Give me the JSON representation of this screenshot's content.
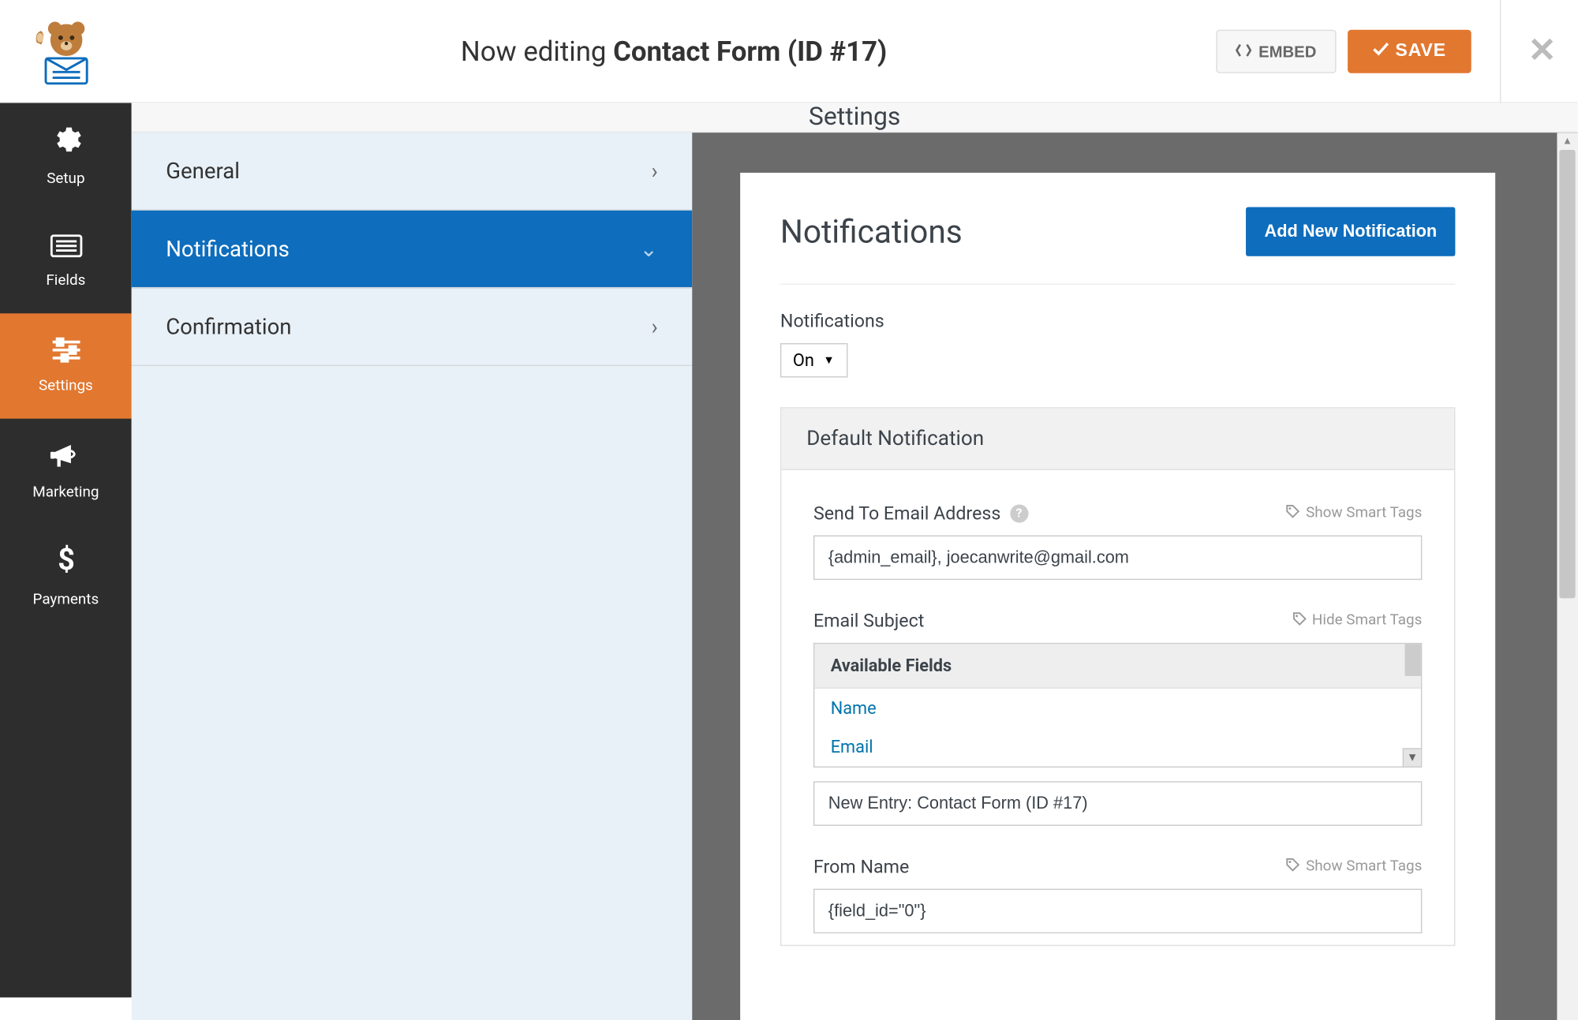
{
  "header": {
    "prefix": "Now editing ",
    "form_name": "Contact Form (ID #17)",
    "embed_label": "EMBED",
    "save_label": "SAVE"
  },
  "sidebar": {
    "items": [
      {
        "label": "Setup"
      },
      {
        "label": "Fields"
      },
      {
        "label": "Settings"
      },
      {
        "label": "Marketing"
      },
      {
        "label": "Payments"
      }
    ]
  },
  "section": {
    "title": "Settings",
    "sub_items": [
      {
        "label": "General"
      },
      {
        "label": "Notifications"
      },
      {
        "label": "Confirmation"
      }
    ]
  },
  "panel": {
    "title": "Notifications",
    "add_button": "Add New Notification",
    "toggle_label": "Notifications",
    "toggle_value": "On",
    "default_header": "Default Notification",
    "send_to_label": "Send To Email Address",
    "send_to_value": "{admin_email}, joecanwrite@gmail.com",
    "show_smart_tags": "Show Smart Tags",
    "hide_smart_tags": "Hide Smart Tags",
    "email_subject_label": "Email Subject",
    "available_fields_header": "Available Fields",
    "available_fields": [
      "Name",
      "Email"
    ],
    "email_subject_value": "New Entry: Contact Form (ID #17)",
    "from_name_label": "From Name",
    "from_name_value": "{field_id=\"0\"}"
  }
}
